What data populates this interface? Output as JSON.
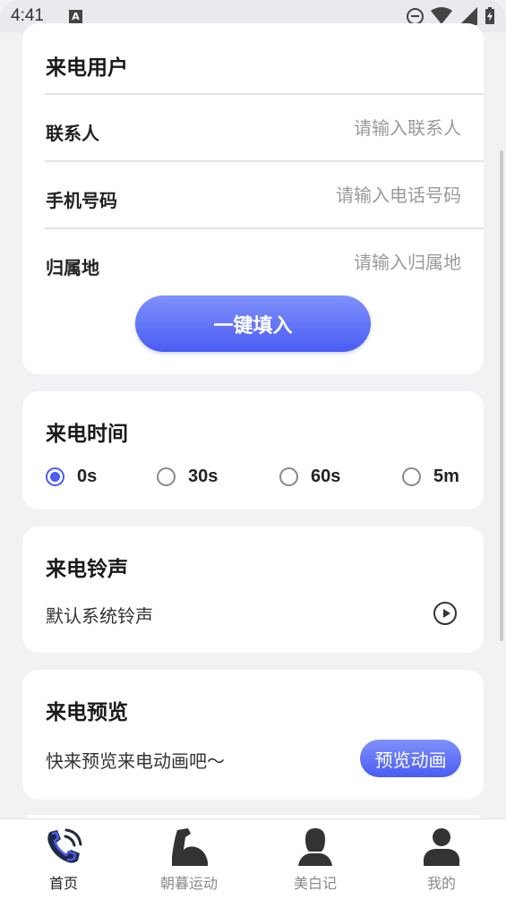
{
  "status_bar": {
    "time": "4:41",
    "notif_letter": "A"
  },
  "caller_card": {
    "title": "来电用户",
    "fields": [
      {
        "label": "联系人",
        "placeholder": "请输入联系人"
      },
      {
        "label": "手机号码",
        "placeholder": "请输入电话号码"
      },
      {
        "label": "归属地",
        "placeholder": "请输入归属地"
      }
    ],
    "fill_button": "一键填入"
  },
  "time_card": {
    "title": "来电时间",
    "options": [
      "0s",
      "30s",
      "60s",
      "5m"
    ],
    "selected": "0s"
  },
  "ringtone_card": {
    "title": "来电铃声",
    "current": "默认系统铃声"
  },
  "preview_card": {
    "title": "来电预览",
    "text": "快来预览来电动画吧～",
    "button": "预览动画"
  },
  "tabbar": {
    "items": [
      {
        "label": "首页",
        "icon": "phone-icon",
        "active": true
      },
      {
        "label": "朝暮运动",
        "icon": "muscle-icon",
        "active": false
      },
      {
        "label": "美白记",
        "icon": "woman-icon",
        "active": false
      },
      {
        "label": "我的",
        "icon": "person-icon",
        "active": false
      }
    ]
  },
  "colors": {
    "accent": "#4a5cf3",
    "accent_light": "#7f91fb",
    "background": "#f2f2f4"
  }
}
